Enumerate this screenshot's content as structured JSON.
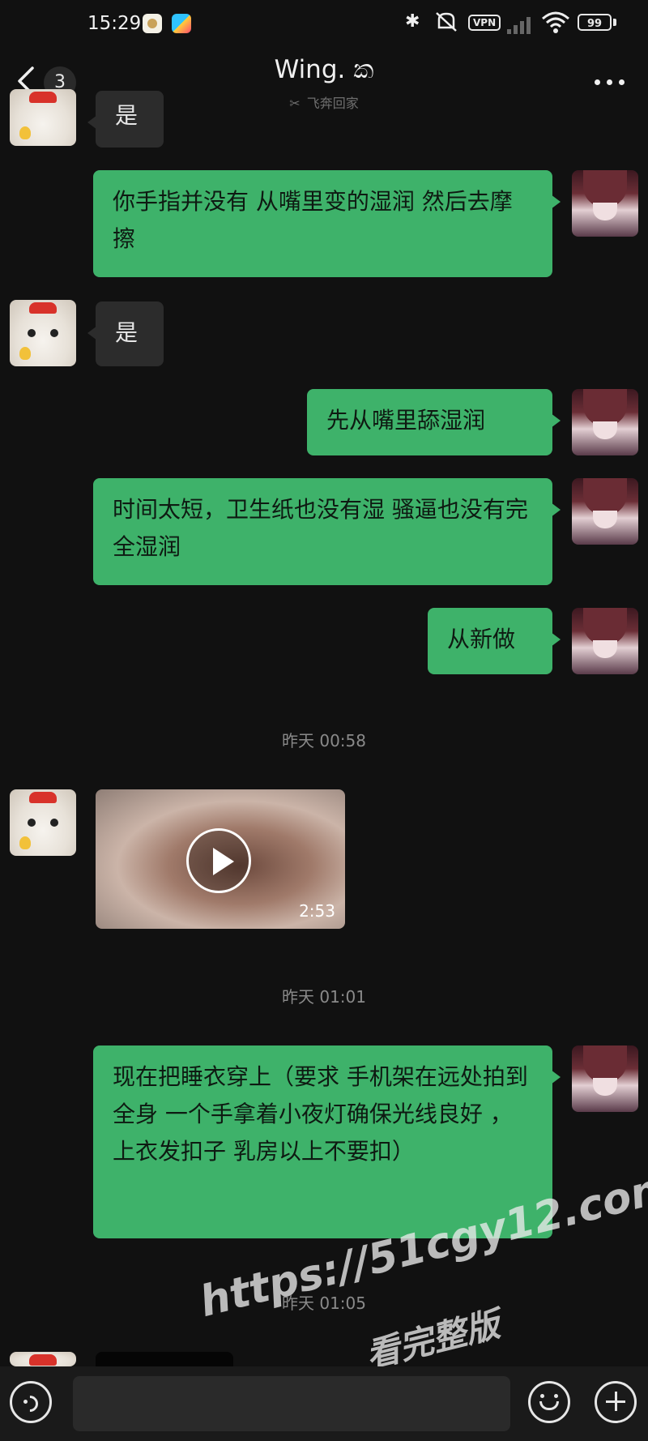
{
  "status_bar": {
    "time": "15:29",
    "vpn": "VPN",
    "battery": "99"
  },
  "header": {
    "back_icon": "chevron-left-icon",
    "unread_count": "3",
    "title": "Wing. ක",
    "subtitle": "飞奔回家",
    "more_icon": "more-dots-icon"
  },
  "messages": [
    {
      "side": "them",
      "text": "是"
    },
    {
      "side": "me",
      "text": "你手指并没有 从嘴里变的湿润 然后去摩擦"
    },
    {
      "side": "them",
      "text": "是"
    },
    {
      "side": "me",
      "text": "先从嘴里舔湿润"
    },
    {
      "side": "me",
      "text": "时间太短，卫生纸也没有湿 骚逼也没有完全湿润"
    },
    {
      "side": "me",
      "text": "从新做"
    },
    {
      "type": "timestamp",
      "text": "昨天 00:58"
    },
    {
      "side": "them",
      "type": "video",
      "duration": "2:53"
    },
    {
      "type": "timestamp",
      "text": "昨天 01:01"
    },
    {
      "side": "me",
      "text": "现在把睡衣穿上（要求 手机架在远处拍到全身 一个手拿着小夜灯确保光线良好 ，上衣发扣子 乳房以上不要扣）"
    },
    {
      "type": "timestamp",
      "text": "昨天 01:05"
    }
  ],
  "watermark": {
    "url": "https://51cgy12.com",
    "text": "看完整版"
  },
  "input_bar": {
    "voice_icon": "voice-icon",
    "emoji_icon": "emoji-icon",
    "plus_icon": "plus-icon"
  }
}
